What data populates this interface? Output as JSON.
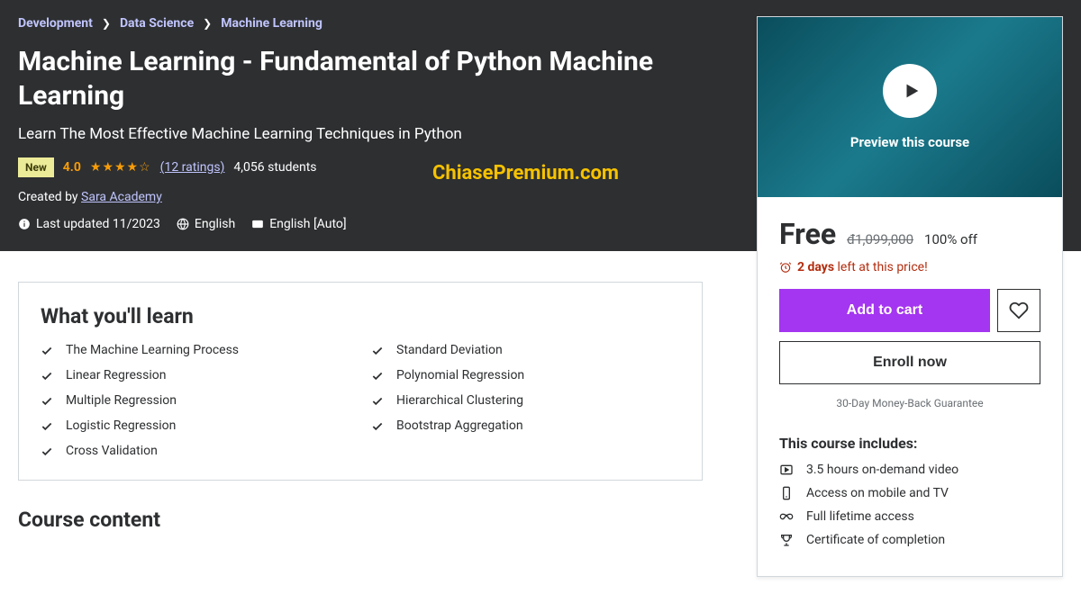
{
  "breadcrumb": {
    "items": [
      "Development",
      "Data Science",
      "Machine Learning"
    ]
  },
  "title": "Machine Learning - Fundamental of Python Machine Learning",
  "subtitle": "Learn The Most Effective Machine Learning Techniques in Python",
  "badge_new": "New",
  "rating": {
    "value": "4.0",
    "stars": "★★★★☆",
    "count_text": "(12 ratings)",
    "students": "4,056 students"
  },
  "watermark": "ChiasePremium.com",
  "creator": {
    "prefix": "Created by ",
    "name": "Sara Academy"
  },
  "meta": {
    "updated": "Last updated 11/2023",
    "language": "English",
    "captions": "English [Auto]"
  },
  "preview_label": "Preview this course",
  "price": {
    "free": "Free",
    "original": "đ1,099,000",
    "discount": "100% off"
  },
  "urgency": {
    "bold": "2 days",
    "rest": " left at this price!"
  },
  "buttons": {
    "add_to_cart": "Add to cart",
    "enroll": "Enroll now"
  },
  "guarantee": "30-Day Money-Back Guarantee",
  "includes": {
    "title": "This course includes:",
    "items": [
      "3.5 hours on-demand video",
      "Access on mobile and TV",
      "Full lifetime access",
      "Certificate of completion"
    ]
  },
  "learn": {
    "title": "What you'll learn",
    "items_col1": [
      "The Machine Learning Process",
      "Linear Regression",
      "Multiple Regression",
      "Logistic Regression",
      "Cross Validation"
    ],
    "items_col2": [
      "Standard Deviation",
      "Polynomial Regression",
      "Hierarchical Clustering",
      "Bootstrap Aggregation"
    ]
  },
  "course_content_title": "Course content"
}
